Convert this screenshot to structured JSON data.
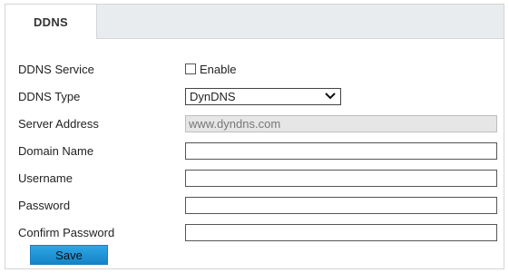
{
  "tab": {
    "label": "DDNS"
  },
  "form": {
    "ddns_service": {
      "label": "DDNS Service",
      "checkbox_label": "Enable",
      "checked": false
    },
    "ddns_type": {
      "label": "DDNS Type",
      "value": "DynDNS",
      "icon": "chevron-down-icon"
    },
    "server_address": {
      "label": "Server Address",
      "value": "www.dyndns.com"
    },
    "domain_name": {
      "label": "Domain Name",
      "value": ""
    },
    "username": {
      "label": "Username",
      "value": ""
    },
    "password": {
      "label": "Password",
      "value": ""
    },
    "confirm_password": {
      "label": "Confirm Password",
      "value": ""
    }
  },
  "save_label": "Save",
  "colors": {
    "accent": "#1e94d6",
    "tab_bg": "#e9ecef",
    "readonly_bg": "#e6e6e6"
  }
}
